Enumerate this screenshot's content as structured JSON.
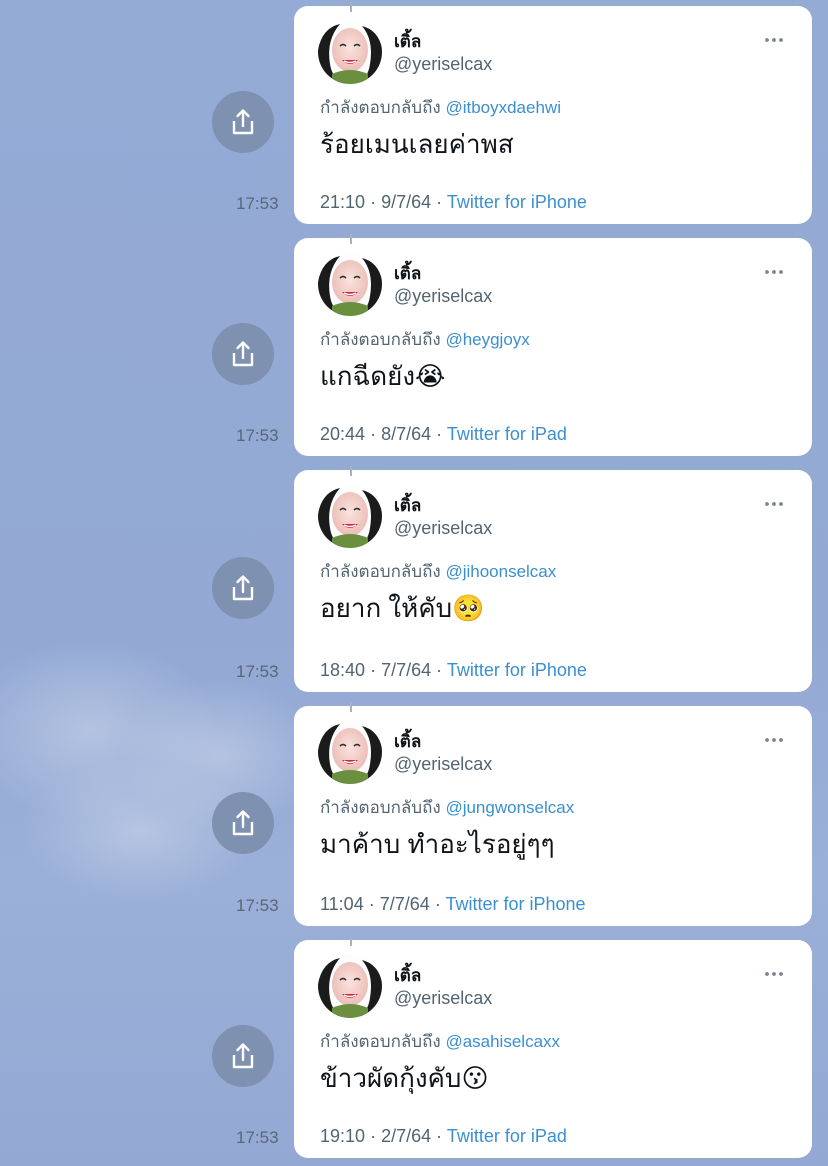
{
  "tweets": [
    {
      "display_name": "เติ้ล",
      "handle": "@yeriselcax",
      "reply_prefix": "กำลังตอบกลับถึง",
      "reply_to": "@itboyxdaehwi",
      "text": "ร้อยเมนเลยค่าพส",
      "emoji": "",
      "time": "21:10",
      "date": "9/7/64",
      "source": "Twitter for iPhone",
      "sent_time": "17:53"
    },
    {
      "display_name": "เติ้ล",
      "handle": "@yeriselcax",
      "reply_prefix": "กำลังตอบกลับถึง",
      "reply_to": "@heygjoyx",
      "text": "แกฉีดยัง",
      "emoji": "😭",
      "time": "20:44",
      "date": "8/7/64",
      "source": "Twitter for iPad",
      "sent_time": "17:53"
    },
    {
      "display_name": "เติ้ล",
      "handle": "@yeriselcax",
      "reply_prefix": "กำลังตอบกลับถึง",
      "reply_to": "@jihoonselcax",
      "text": "อยาก ให้คับ",
      "emoji": "🥺",
      "time": "18:40",
      "date": "7/7/64",
      "source": "Twitter for iPhone",
      "sent_time": "17:53"
    },
    {
      "display_name": "เติ้ล",
      "handle": "@yeriselcax",
      "reply_prefix": "กำลังตอบกลับถึง",
      "reply_to": "@jungwonselcax",
      "text": "มาค้าบ ทำอะไรอยู่ๆๆ",
      "emoji": "",
      "time": "11:04",
      "date": "7/7/64",
      "source": "Twitter for iPhone",
      "sent_time": "17:53"
    },
    {
      "display_name": "เติ้ล",
      "handle": "@yeriselcax",
      "reply_prefix": "กำลังตอบกลับถึง",
      "reply_to": "@asahiselcaxx",
      "text": "ข้าวผัดกุ้งคับ",
      "emoji": "😗",
      "time": "19:10",
      "date": "2/7/64",
      "source": "Twitter for iPad",
      "sent_time": "17:53"
    }
  ],
  "meta_separator": "·",
  "icons": {
    "share": "share-icon",
    "more": "more-options-icon",
    "avatar": "avatar"
  },
  "colors": {
    "background": "#94abd6",
    "share_button": "#7e91b0",
    "link": "#3b8fd0",
    "secondary_text": "#536471"
  }
}
